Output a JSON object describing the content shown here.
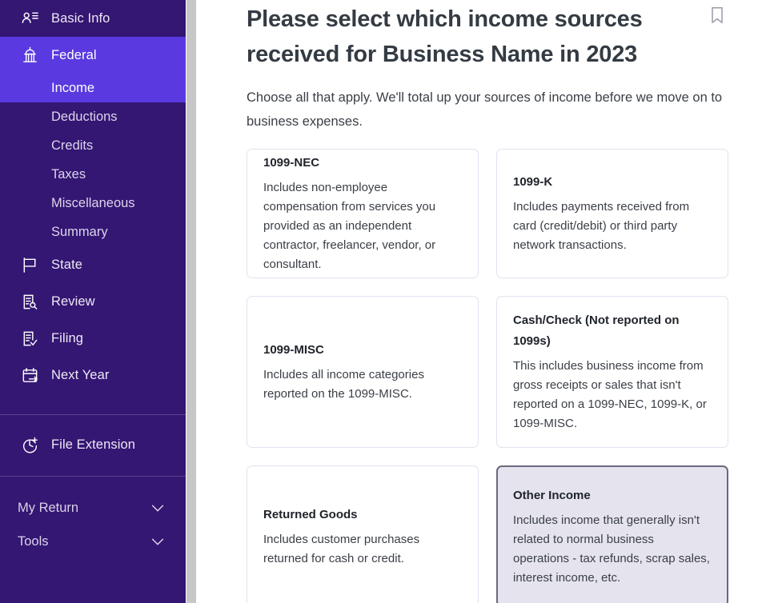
{
  "sidebar": {
    "items": [
      {
        "label": "Basic Info",
        "icon": "person-list-icon",
        "key": "basic-info"
      },
      {
        "label": "Federal",
        "icon": "capitol-building-icon",
        "key": "federal"
      },
      {
        "label": "State",
        "icon": "flag-icon",
        "key": "state"
      },
      {
        "label": "Review",
        "icon": "document-search-icon",
        "key": "review"
      },
      {
        "label": "Filing",
        "icon": "document-check-icon",
        "key": "filing"
      },
      {
        "label": "Next Year",
        "icon": "calendar-arrow-icon",
        "key": "next-year"
      }
    ],
    "federal_subitems": [
      {
        "label": "Income",
        "selected": true
      },
      {
        "label": "Deductions",
        "selected": false
      },
      {
        "label": "Credits",
        "selected": false
      },
      {
        "label": "Taxes",
        "selected": false
      },
      {
        "label": "Miscellaneous",
        "selected": false
      },
      {
        "label": "Summary",
        "selected": false
      }
    ],
    "file_extension": {
      "label": "File Extension",
      "icon": "clock-plus-icon"
    },
    "collapsibles": [
      {
        "label": "My Return",
        "icon": "chevron-down-icon"
      },
      {
        "label": "Tools",
        "icon": "chevron-down-icon"
      }
    ],
    "colors": {
      "background": "#341673",
      "active": "#5a3ae0",
      "text": "#ece9f3"
    }
  },
  "main": {
    "title": "Please select which income sources received for Business Name in 2023",
    "subtitle": "Choose all that apply. We'll total up your sources of income before we move on to business expenses.",
    "bookmark_icon": "bookmark-icon",
    "cards": [
      {
        "title": "1099-NEC",
        "description": "Includes non-employee compensation from services you provided as an independent contractor, freelancer, vendor, or consultant.",
        "selected": false
      },
      {
        "title": "1099-K",
        "description": "Includes payments received from card (credit/debit) or third party network transactions.",
        "selected": false
      },
      {
        "title": "1099-MISC",
        "description": "Includes all income categories reported on the 1099-MISC.",
        "selected": false
      },
      {
        "title": "Cash/Check (Not reported on 1099s)",
        "description": "This includes business income from gross receipts or sales that isn't reported on a 1099-NEC, 1099-K, or 1099-MISC.",
        "selected": false
      },
      {
        "title": "Returned Goods",
        "description": "Includes customer purchases returned for cash or credit.",
        "selected": false
      },
      {
        "title": "Other Income",
        "description": "Includes income that generally isn't related to normal business operations - tax refunds, scrap sales, interest income, etc.",
        "selected": true
      }
    ],
    "colors": {
      "card_border": "#e3e1ef",
      "card_selected_bg": "#e5e4ee",
      "card_selected_border": "#6b687e",
      "title_text": "#343b43"
    }
  },
  "scrollbar": {
    "name": "vertical-scrollbar"
  }
}
